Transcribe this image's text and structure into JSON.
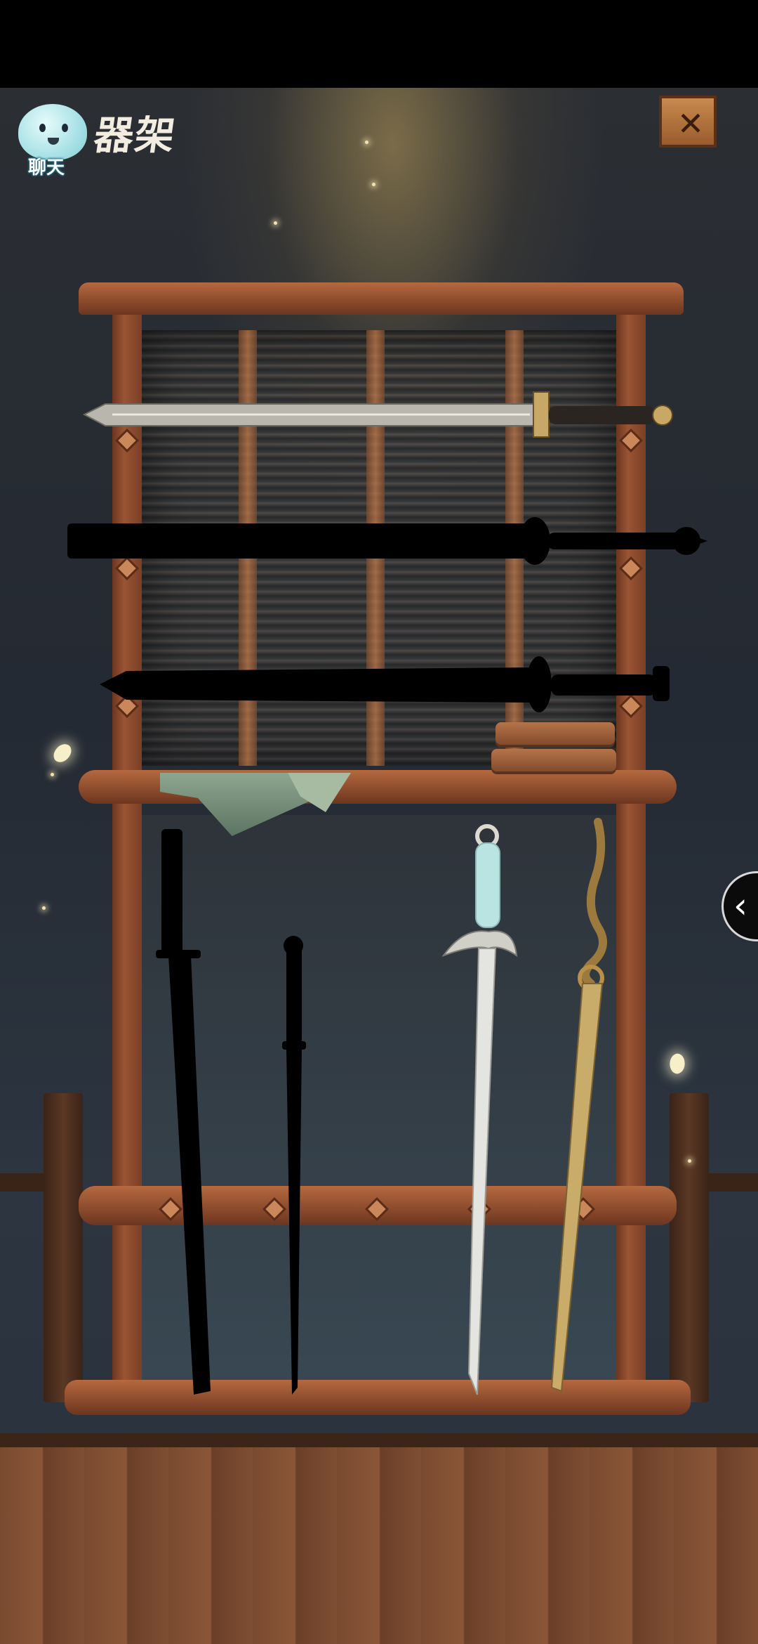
{
  "header": {
    "title": "器架",
    "chat_label": "聊天",
    "close_symbol": "✕"
  },
  "side_tab": {
    "chevron": "‹"
  },
  "rack": {
    "top_shelf_swords": [
      {
        "name": "revealed-jian",
        "state": "revealed"
      },
      {
        "name": "silhouette-saber",
        "state": "locked"
      },
      {
        "name": "silhouette-sword",
        "state": "locked"
      }
    ],
    "standing_swords": [
      {
        "name": "silhouette-long-saber",
        "state": "locked"
      },
      {
        "name": "silhouette-thin-sword",
        "state": "locked"
      },
      {
        "name": "white-jade-sword",
        "state": "revealed"
      },
      {
        "name": "golden-serpent-sword",
        "state": "revealed"
      }
    ]
  },
  "icons": {
    "chat": "chat-mascot-icon",
    "close": "close-icon",
    "side": "chevron-left-icon"
  },
  "colors": {
    "wood": "#9a5433",
    "silhouette": "#000000",
    "glow": "#c9a25a"
  }
}
